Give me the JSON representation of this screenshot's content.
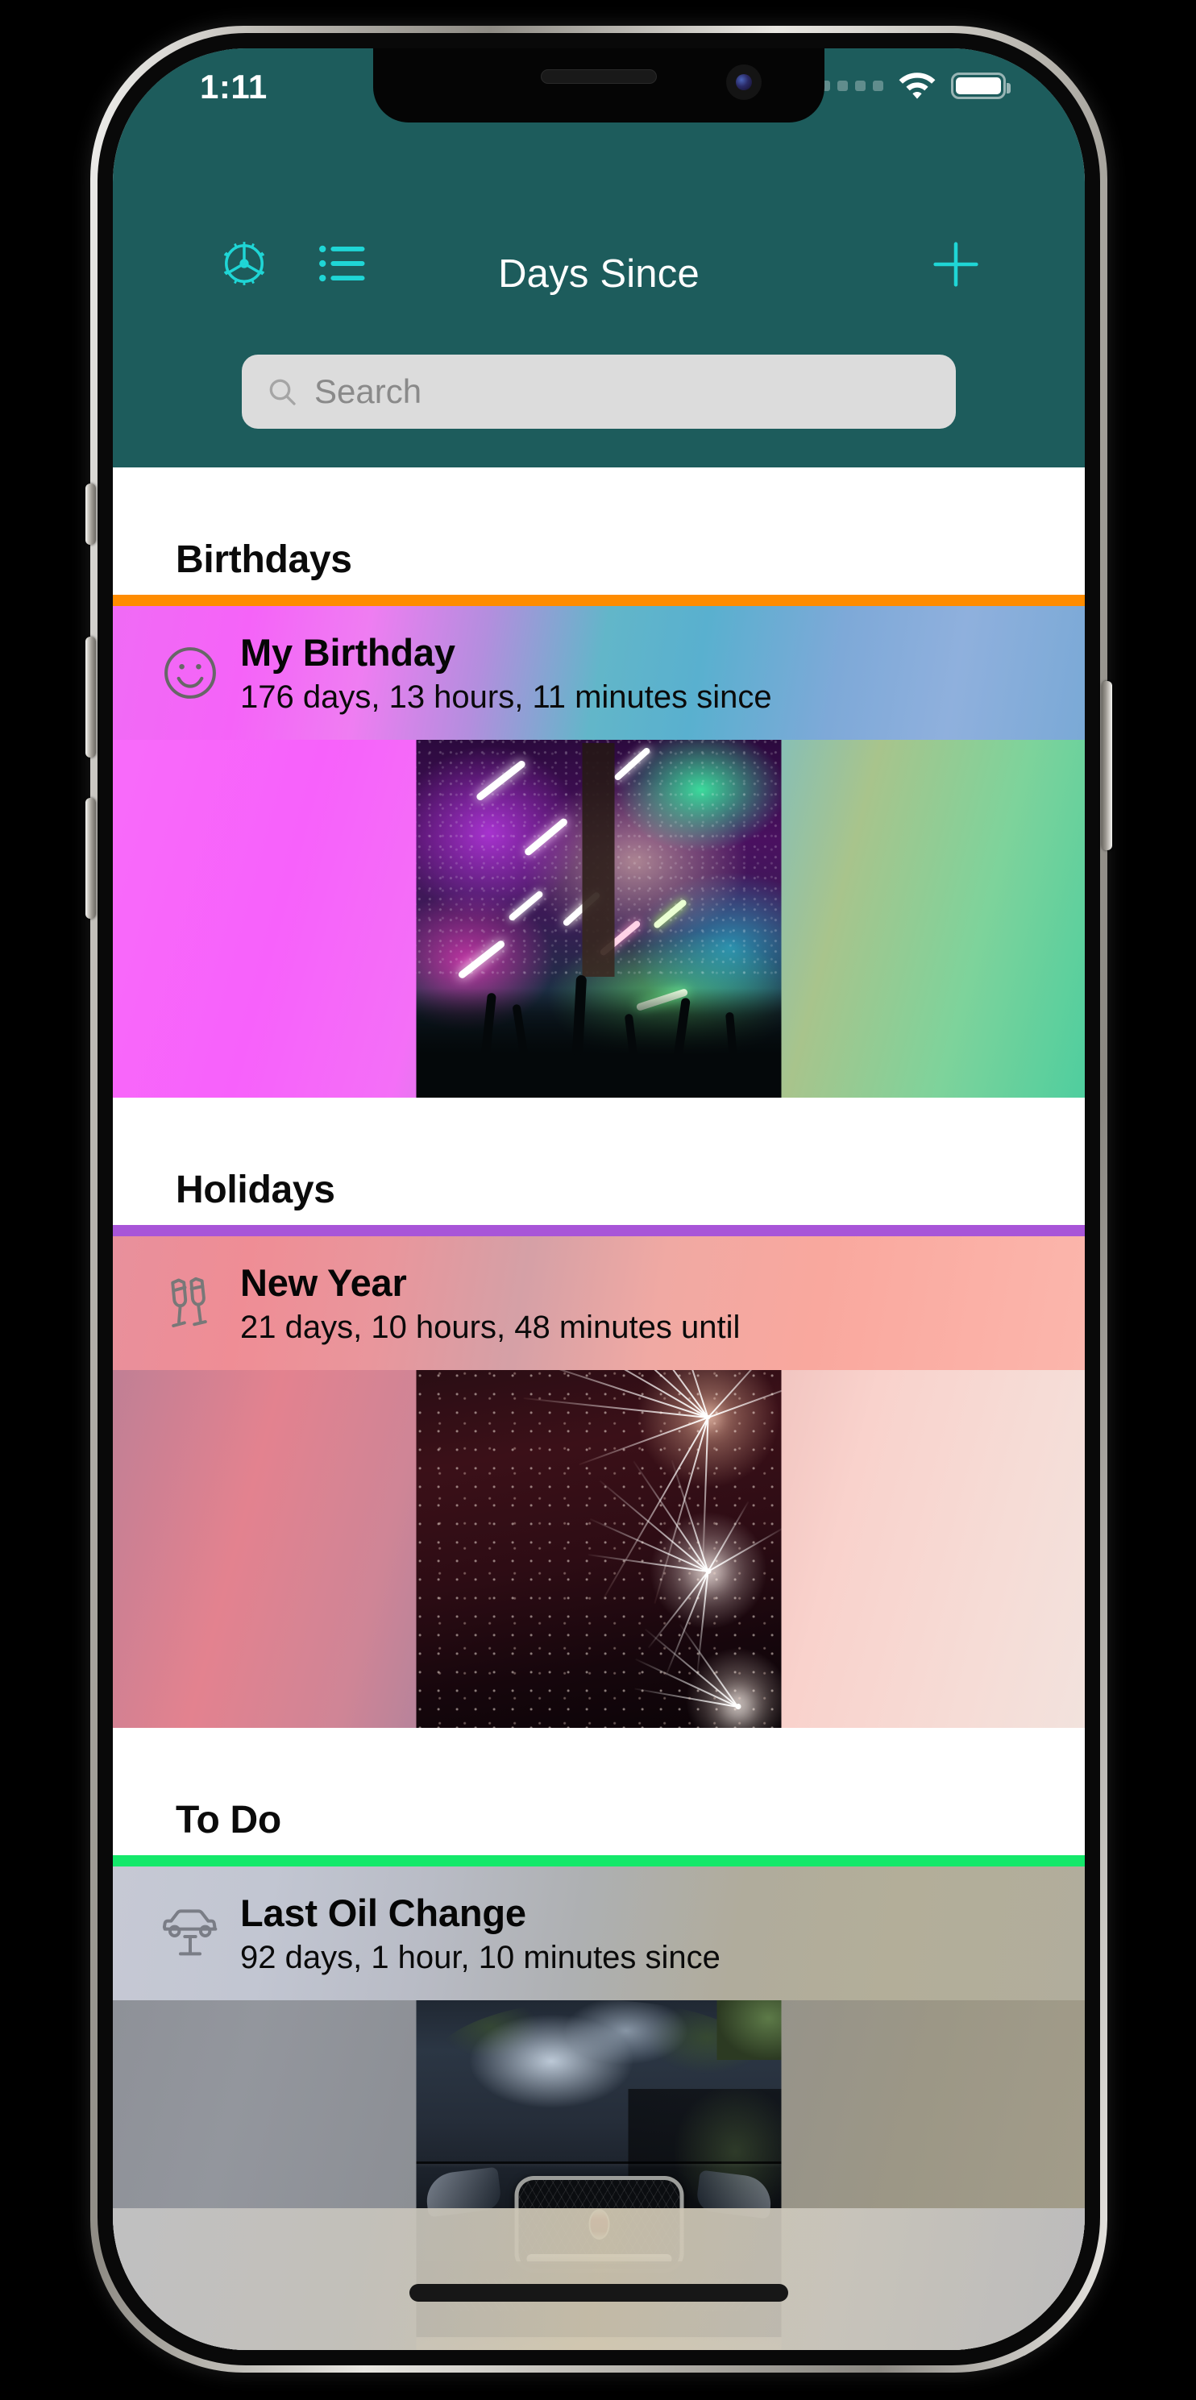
{
  "status_bar": {
    "time": "1:11",
    "cellular_icon": "cellular-dots-icon",
    "wifi_icon": "wifi-icon",
    "battery_icon": "battery-full-icon"
  },
  "nav_bar": {
    "title": "Days Since",
    "settings_icon": "gear-icon",
    "list_icon": "list-icon",
    "add_icon": "plus-icon",
    "accent_color": "#1fd6d6",
    "background_color": "#1d5c5c"
  },
  "search": {
    "placeholder": "Search",
    "icon": "search-icon"
  },
  "sections": [
    {
      "header": "Birthdays",
      "accent_color": "#ff8c00",
      "entry": {
        "icon": "smiley-face-icon",
        "title": "My Birthday",
        "subtitle": "176 days, 13 hours, 11 minutes since",
        "photo": "concert-crowd-lights-photo"
      }
    },
    {
      "header": "Holidays",
      "accent_color": "#a855d8",
      "entry": {
        "icon": "champagne-glasses-icon",
        "title": "New Year",
        "subtitle": "21 days, 10 hours, 48 minutes until",
        "photo": "fireworks-photo"
      }
    },
    {
      "header": "To Do",
      "accent_color": "#14e86a",
      "entry": {
        "icon": "car-on-lift-icon",
        "title": "Last Oil Change",
        "subtitle": "92 days, 1 hour, 10 minutes since",
        "photo": "black-car-front-photo"
      }
    }
  ],
  "home_indicator": "home-indicator-bar"
}
